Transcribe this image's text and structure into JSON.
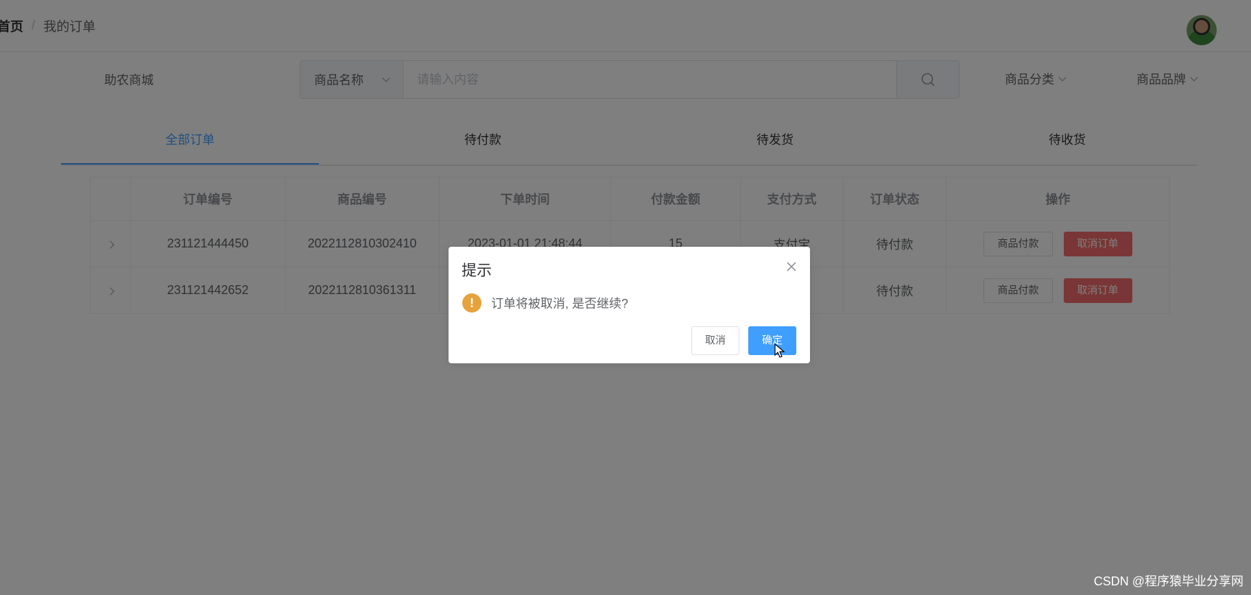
{
  "breadcrumb": {
    "home": "首页",
    "separator": "/",
    "current": "我的订单"
  },
  "header": {
    "shop_name": "助农商城",
    "search": {
      "select_value": "商品名称",
      "placeholder": "请输入内容"
    },
    "nav": [
      "商品分类",
      "商品品牌"
    ]
  },
  "tabs": [
    {
      "label": "全部订单",
      "active": true
    },
    {
      "label": "待付款",
      "active": false
    },
    {
      "label": "待发货",
      "active": false
    },
    {
      "label": "待收货",
      "active": false
    }
  ],
  "table": {
    "headers": [
      "订单编号",
      "商品编号",
      "下单时间",
      "付款金额",
      "支付方式",
      "订单状态",
      "操作"
    ],
    "rows": [
      {
        "order_no": "231121444450",
        "product_no": "2022112810302410",
        "time": "2023-01-01 21:48:44",
        "amount": "15",
        "pay_method": "支付宝",
        "status": "待付款"
      },
      {
        "order_no": "231121442652",
        "product_no": "2022112810361311",
        "time": "",
        "amount": "",
        "pay_method": "",
        "status": "待付款"
      }
    ],
    "actions": {
      "pay": "商品付款",
      "cancel": "取消订单"
    }
  },
  "dialog": {
    "title": "提示",
    "message": "订单将被取消, 是否继续?",
    "cancel": "取消",
    "confirm": "确定"
  },
  "watermark": "CSDN @程序猿毕业分享网",
  "colors": {
    "primary": "#409eff",
    "danger": "#f56c6c",
    "warning": "#e6a23c"
  }
}
